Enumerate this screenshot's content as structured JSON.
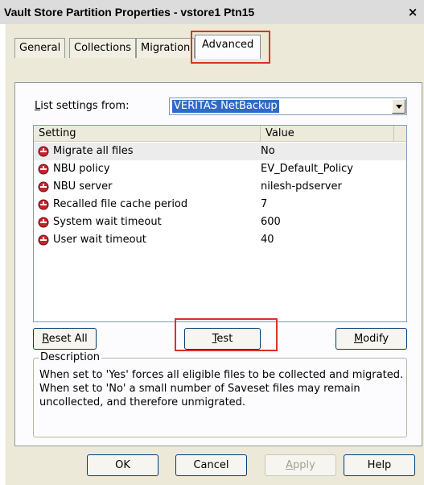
{
  "window": {
    "title": "Vault Store Partition Properties - vstore1 Ptn15",
    "close_glyph": "×"
  },
  "tabs": [
    {
      "label": "General",
      "active": false
    },
    {
      "label": "Collections",
      "active": false
    },
    {
      "label": "Migration",
      "active": false
    },
    {
      "label": "Advanced",
      "active": true
    }
  ],
  "settings_source": {
    "label": "List settings from:",
    "selected": "VERITAS NetBackup"
  },
  "list": {
    "columns": [
      "Setting",
      "Value"
    ],
    "rows": [
      {
        "setting": "Migrate all files",
        "value": "No",
        "icon": "setting-red-icon"
      },
      {
        "setting": "NBU policy",
        "value": "EV_Default_Policy",
        "icon": "setting-red-icon"
      },
      {
        "setting": "NBU server",
        "value": "nilesh-pdserver",
        "icon": "setting-red-icon"
      },
      {
        "setting": "Recalled file cache period",
        "value": "7",
        "icon": "setting-red-icon"
      },
      {
        "setting": "System wait timeout",
        "value": "600",
        "icon": "setting-red-icon"
      },
      {
        "setting": "User wait timeout",
        "value": "40",
        "icon": "setting-red-icon"
      }
    ]
  },
  "actions": {
    "reset_all": "Reset All",
    "test": "Test",
    "modify": "Modify"
  },
  "description": {
    "legend": "Description",
    "text": "When set to 'Yes' forces all eligible files to be collected and migrated. When set to 'No' a small number of Saveset files may remain uncollected, and therefore unmigrated."
  },
  "footer": {
    "ok": "OK",
    "cancel": "Cancel",
    "apply": "Apply",
    "help": "Help"
  },
  "colors": {
    "highlight_box": "#d9322c",
    "selection": "#316ac5",
    "dialog_face": "#ece9d8"
  }
}
